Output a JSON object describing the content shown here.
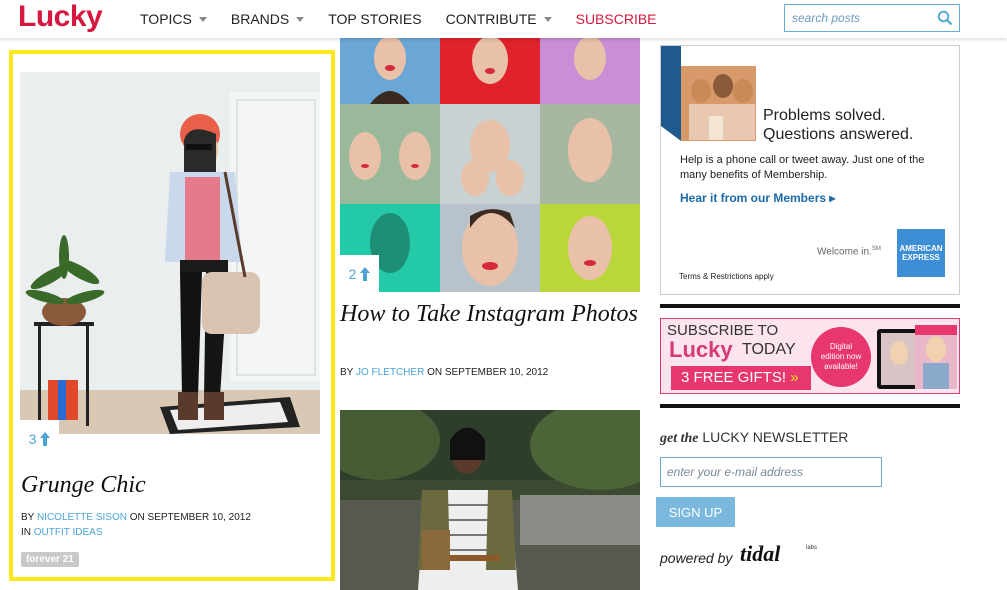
{
  "header": {
    "logo": "Lucky",
    "nav": [
      {
        "label": "TOPICS",
        "dropdown": true
      },
      {
        "label": "BRANDS",
        "dropdown": true
      },
      {
        "label": "TOP STORIES",
        "dropdown": false
      },
      {
        "label": "CONTRIBUTE",
        "dropdown": true
      },
      {
        "label": "SUBSCRIBE",
        "dropdown": false
      }
    ],
    "search_placeholder": "search posts"
  },
  "featured": {
    "count": "3",
    "title": "Grunge Chic",
    "by": "BY",
    "author": "NICOLETTE SISON",
    "date": "ON SEPTEMBER 10, 2012",
    "in": "IN",
    "category": "OUTFIT IDEAS",
    "tag": "forever 21"
  },
  "middle": {
    "count": "2",
    "title": "How to Take Instagram Photos",
    "by": "BY",
    "author": "JO FLETCHER",
    "date": "ON SEPTEMBER 10, 2012"
  },
  "ad_membership": {
    "headline_1": "Problems solved.",
    "headline_2": "Questions answered.",
    "body": "Help is a phone call or tweet away. Just one of the many benefits of Membership.",
    "link": "Hear it from our Members",
    "welcome": "Welcome in.",
    "sm": "SM",
    "terms": "Terms & Restrictions apply",
    "amex_1": "AMERICAN",
    "amex_2": "EXPRESS"
  },
  "ad_subscribe": {
    "line1": "SUBSCRIBE TO",
    "brand": "Lucky",
    "today": "TODAY",
    "gifts": "3 FREE GIFTS!",
    "circle_1": "Digital",
    "circle_2": "edition now",
    "circle_3": "available!"
  },
  "newsletter": {
    "title_prefix": "get the",
    "title_rest": "LUCKY NEWSLETTER",
    "email_placeholder": "enter your e-mail address",
    "button": "SIGN UP",
    "powered_by": "powered by",
    "tidal": "tidal",
    "labs": "labs"
  }
}
